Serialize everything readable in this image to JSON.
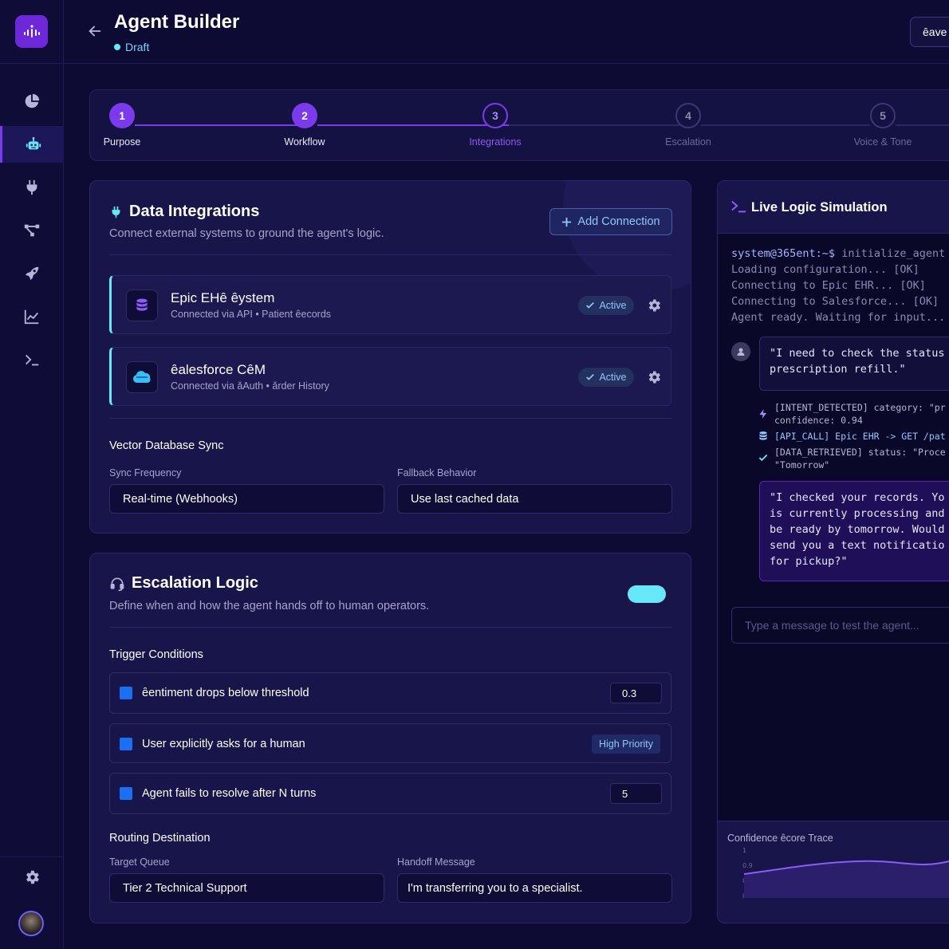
{
  "header": {
    "title": "Agent Builder",
    "status": "Draft",
    "save_label": "ȇave"
  },
  "sidebar": {
    "items": [
      {
        "icon": "pie-chart-icon"
      },
      {
        "icon": "robot-icon",
        "active": true
      },
      {
        "icon": "plug-icon"
      },
      {
        "icon": "workflow-icon"
      },
      {
        "icon": "rocket-icon"
      },
      {
        "icon": "chart-line-icon"
      },
      {
        "icon": "terminal-icon"
      }
    ],
    "bottom": {
      "settings_icon": "gear-icon",
      "avatar": "user-avatar"
    }
  },
  "stepper": {
    "steps": [
      {
        "num": "1",
        "label": "Purpose",
        "state": "done"
      },
      {
        "num": "2",
        "label": "Workflow",
        "state": "done"
      },
      {
        "num": "3",
        "label": "Integrations",
        "state": "current"
      },
      {
        "num": "4",
        "label": "Escalation",
        "state": "future"
      },
      {
        "num": "5",
        "label": "Voice & Tone",
        "state": "future"
      }
    ]
  },
  "integrations": {
    "title": "Data Integrations",
    "subtitle": "Connect external systems to ground the agent's logic.",
    "add_label": "Add Connection",
    "connections": [
      {
        "name": "Epic EHȇ ȇystem",
        "meta": "Connected via API • Patient ȇecords",
        "status": "Active",
        "icon": "database-icon"
      },
      {
        "name": "ȇalesforce CȇM",
        "meta": "Connected via ǎAuth • ǎrder History",
        "status": "Active",
        "icon": "salesforce-icon"
      }
    ],
    "vector_title": "Vector Database Sync",
    "sync_label": "Sync Frequency",
    "sync_value": "Real-time (Webhooks)",
    "fallback_label": "Fallback Behavior",
    "fallback_value": "Use last cached data"
  },
  "escalation": {
    "title": "Escalation Logic",
    "subtitle": "Define when and how the agent hands off to human operators.",
    "enabled": true,
    "triggers_title": "Trigger Conditions",
    "triggers": [
      {
        "label": "ȇentiment drops below threshold",
        "value": "0.3"
      },
      {
        "label": "User explicitly asks for a human",
        "badge": "High Priority"
      },
      {
        "label": "Agent fails to resolve after N turns",
        "value": "5"
      }
    ],
    "routing_title": "Routing Destination",
    "queue_label": "Target Queue",
    "queue_value": "Tier 2 Technical Support",
    "handoff_label": "Handoff Message",
    "handoff_value": "I'm transferring you to a specialist."
  },
  "simulation": {
    "title": "Live Logic Simulation",
    "prompt": "system@365ent:~$",
    "command": "initialize_agent",
    "boot_lines": [
      "Loading configuration... [OK]",
      "Connecting to Epic EHR... [OK]",
      "Connecting to Salesforce... [OK]",
      "Agent ready. Waiting for input..."
    ],
    "user_message": "\"I need to check the status\nprescription refill.\"",
    "logs": [
      {
        "line1": "[INTENT_DETECTED] category: \"pr",
        "line2": "confidence: 0.94",
        "icon": "bolt-icon"
      },
      {
        "line1": "[API_CALL] Epic EHR -> GET /pat",
        "line2": "",
        "icon": "database-icon"
      },
      {
        "line1": "[DATA_RETRIEVED] status: \"Proce",
        "line2": "\"Tomorrow\"",
        "icon": "check-icon"
      }
    ],
    "agent_message": "\"I checked your records. Yo\nis currently processing and\nbe ready by tomorrow. Would\nsend you a text notificatio\nfor pickup?\"",
    "input_placeholder": "Type a message to test the agent...",
    "trace_title": "Confidence ȇcore Trace",
    "trace_ticks": [
      "1",
      "0.9",
      "0.8",
      "0.7"
    ]
  },
  "colors": {
    "accent": "#7c3aed",
    "cyan": "#67e8f9",
    "bg": "#0d0b33",
    "card": "#17154a"
  }
}
